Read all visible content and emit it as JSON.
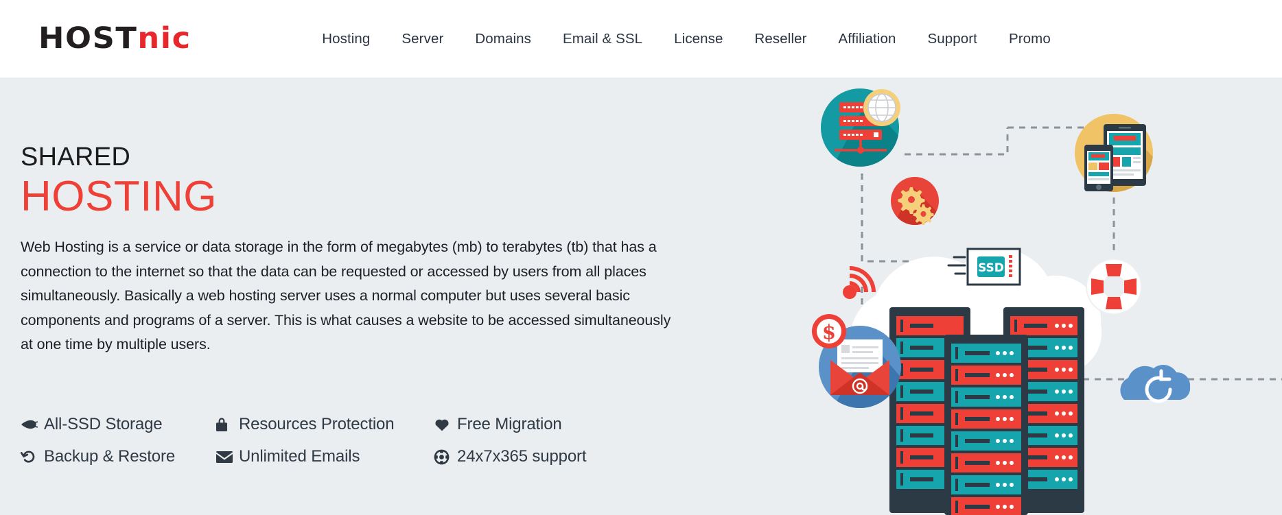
{
  "brand": {
    "logo_dark": "HOST",
    "logo_accent": "NIC",
    "accent_color": "#e8272c",
    "dark_color": "#231f20"
  },
  "nav": {
    "items": [
      {
        "label": "Hosting",
        "name": "nav-item-hosting"
      },
      {
        "label": "Server",
        "name": "nav-item-server"
      },
      {
        "label": "Domains",
        "name": "nav-item-domains"
      },
      {
        "label": "Email & SSL",
        "name": "nav-item-email-ssl"
      },
      {
        "label": "License",
        "name": "nav-item-license"
      },
      {
        "label": "Reseller",
        "name": "nav-item-reseller"
      },
      {
        "label": "Affiliation",
        "name": "nav-item-affiliation"
      },
      {
        "label": "Support",
        "name": "nav-item-support"
      },
      {
        "label": "Promo",
        "name": "nav-item-promo"
      }
    ]
  },
  "hero": {
    "eyebrow": "SHARED",
    "headline": "HOSTING",
    "headline_color": "#ee4036",
    "background_color": "#eaeef0",
    "description": "Web Hosting is a service or data storage in the form of megabytes (mb) to terabytes (tb) that has a connection to the internet so that the data can be requested or accessed by users from all places simultaneously. Basically a web hosting server uses a normal computer but uses several basic components and programs of a server. This is what causes a website to be accessed simultaneously at one time by multiple users.",
    "features": [
      {
        "label": "All-SSD Storage",
        "icon": "plane-icon"
      },
      {
        "label": "Resources Protection",
        "icon": "lock-icon"
      },
      {
        "label": "Free Migration",
        "icon": "heart-icon"
      },
      {
        "label": "Backup & Restore",
        "icon": "rotate-left-icon"
      },
      {
        "label": "Unlimited Emails",
        "icon": "envelope-icon"
      },
      {
        "label": "24x7x365 support",
        "icon": "life-ring-icon"
      }
    ]
  },
  "illustration": {
    "ssd_badge_label": "SSD",
    "money_badge_label": "$",
    "email_badge_label": "@",
    "nodes": [
      {
        "name": "server-globe-node",
        "icon": "server-rack-icon",
        "circle_color": "#149aa2"
      },
      {
        "name": "gears-node",
        "icon": "gears-icon",
        "circle_color": "#e8443a"
      },
      {
        "name": "devices-node",
        "icon": "tablet-phone-icon",
        "circle_color": "#f0c367"
      },
      {
        "name": "support-node",
        "icon": "life-ring-icon",
        "circle_color": "#ee4036"
      },
      {
        "name": "email-node",
        "icon": "envelope-at-icon",
        "circle_color": "#5a91c8"
      },
      {
        "name": "wifi-node",
        "icon": "wifi-signal-icon",
        "circle_color": "#ee4036"
      },
      {
        "name": "cloud-backup-node",
        "icon": "cloud-restore-icon",
        "circle_color": "#5a91c8"
      },
      {
        "name": "datacenter-node",
        "icon": "server-racks-icon",
        "circle_color": "#2c3a45"
      }
    ]
  }
}
